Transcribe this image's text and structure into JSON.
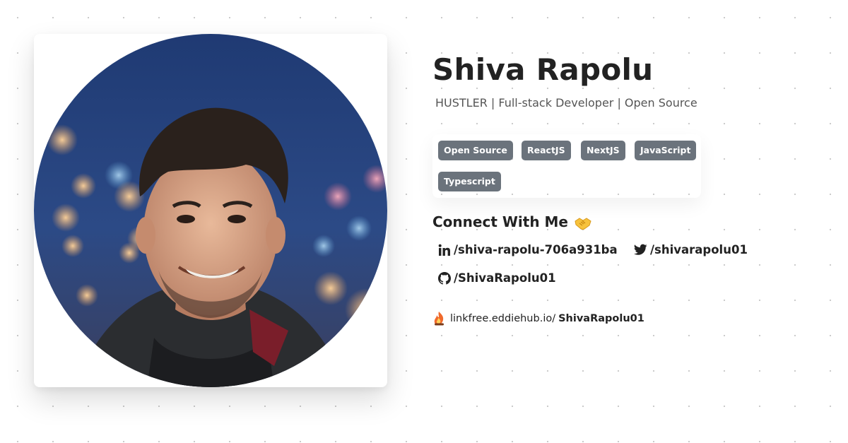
{
  "profile": {
    "name": "Shiva Rapolu",
    "bio": "HUSTLER | Full-stack Developer | Open Source"
  },
  "tags": [
    {
      "label": "Open Source"
    },
    {
      "label": "ReactJS"
    },
    {
      "label": "NextJS"
    },
    {
      "label": "JavaScript"
    },
    {
      "label": "Typescript"
    }
  ],
  "connect": {
    "heading": "Connect With Me",
    "heading_icon": "handshake-icon",
    "links": [
      {
        "platform": "linkedin",
        "icon": "linkedin-icon",
        "label": "/shiva-rapolu-706a931ba"
      },
      {
        "platform": "twitter",
        "icon": "twitter-icon",
        "label": "/shivarapolu01"
      },
      {
        "platform": "github",
        "icon": "github-icon",
        "label": "/ShivaRapolu01"
      }
    ]
  },
  "footer": {
    "icon": "linkfree-logo-icon",
    "prefix": "linkfree.eddiehub.io/",
    "username": "ShivaRapolu01"
  },
  "colors": {
    "tag_bg": "#6b737c",
    "tag_text": "#ffffff",
    "text": "#222222",
    "muted": "#555555"
  }
}
